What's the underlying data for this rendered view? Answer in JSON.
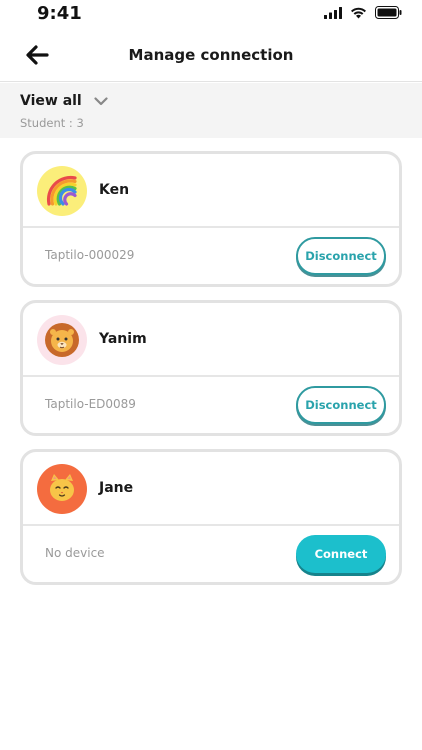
{
  "status_bar": {
    "time": "9:41"
  },
  "header": {
    "title": "Manage connection"
  },
  "filter": {
    "label": "View all",
    "student_count": "Student : 3"
  },
  "colors": {
    "accent": "#1cbfcc",
    "outline": "#2f9aa0",
    "card_border": "#e2e2e2"
  },
  "students": [
    {
      "name": "Ken",
      "avatar_icon": "rainbow-icon",
      "avatar_bg": "#fbee7a",
      "device": "Taptilo-000029",
      "action": "Disconnect"
    },
    {
      "name": "Yanim",
      "avatar_icon": "lion-icon",
      "avatar_bg": "#fbe3ea",
      "device": "Taptilo-ED0089",
      "action": "Disconnect"
    },
    {
      "name": "Jane",
      "avatar_icon": "cat-icon",
      "avatar_bg": "#f46c3f",
      "device": "No device",
      "action": "Connect"
    }
  ]
}
